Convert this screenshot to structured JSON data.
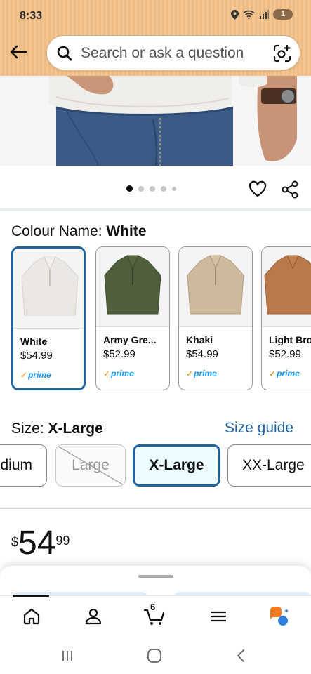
{
  "status": {
    "time": "8:33",
    "notification_count": "1"
  },
  "search": {
    "placeholder": "Search or ask a question"
  },
  "carousel": {
    "total": 5,
    "active": 0
  },
  "colour": {
    "label": "Colour Name: ",
    "selected": "White",
    "options": [
      {
        "name": "White",
        "price": "$54.99",
        "prime": "prime",
        "color": "#ece9e4"
      },
      {
        "name": "Army Gre...",
        "price": "$52.99",
        "prime": "prime",
        "color": "#4a5a3a"
      },
      {
        "name": "Khaki",
        "price": "$54.99",
        "prime": "prime",
        "color": "#cbb79b"
      },
      {
        "name": "Light Bro",
        "price": "$52.99",
        "prime": "prime",
        "color": "#b8794a"
      }
    ]
  },
  "size": {
    "label": "Size: ",
    "selected": "X-Large",
    "guide": "Size guide",
    "options": [
      {
        "label": "dium",
        "state": "available"
      },
      {
        "label": "Large",
        "state": "unavailable"
      },
      {
        "label": "X-Large",
        "state": "selected"
      },
      {
        "label": "XX-Large",
        "state": "available"
      }
    ]
  },
  "price": {
    "currency": "$",
    "whole": "54",
    "fraction": "99"
  },
  "bottom_nav": {
    "cart_count": "6",
    "items": [
      "home-icon",
      "account-icon",
      "cart-icon",
      "menu-icon",
      "rufus-icon"
    ]
  },
  "colors": {
    "accent": "#2162a1",
    "prime": "#1a98ff",
    "prime_check": "#f08804",
    "header": "#f3c591"
  }
}
